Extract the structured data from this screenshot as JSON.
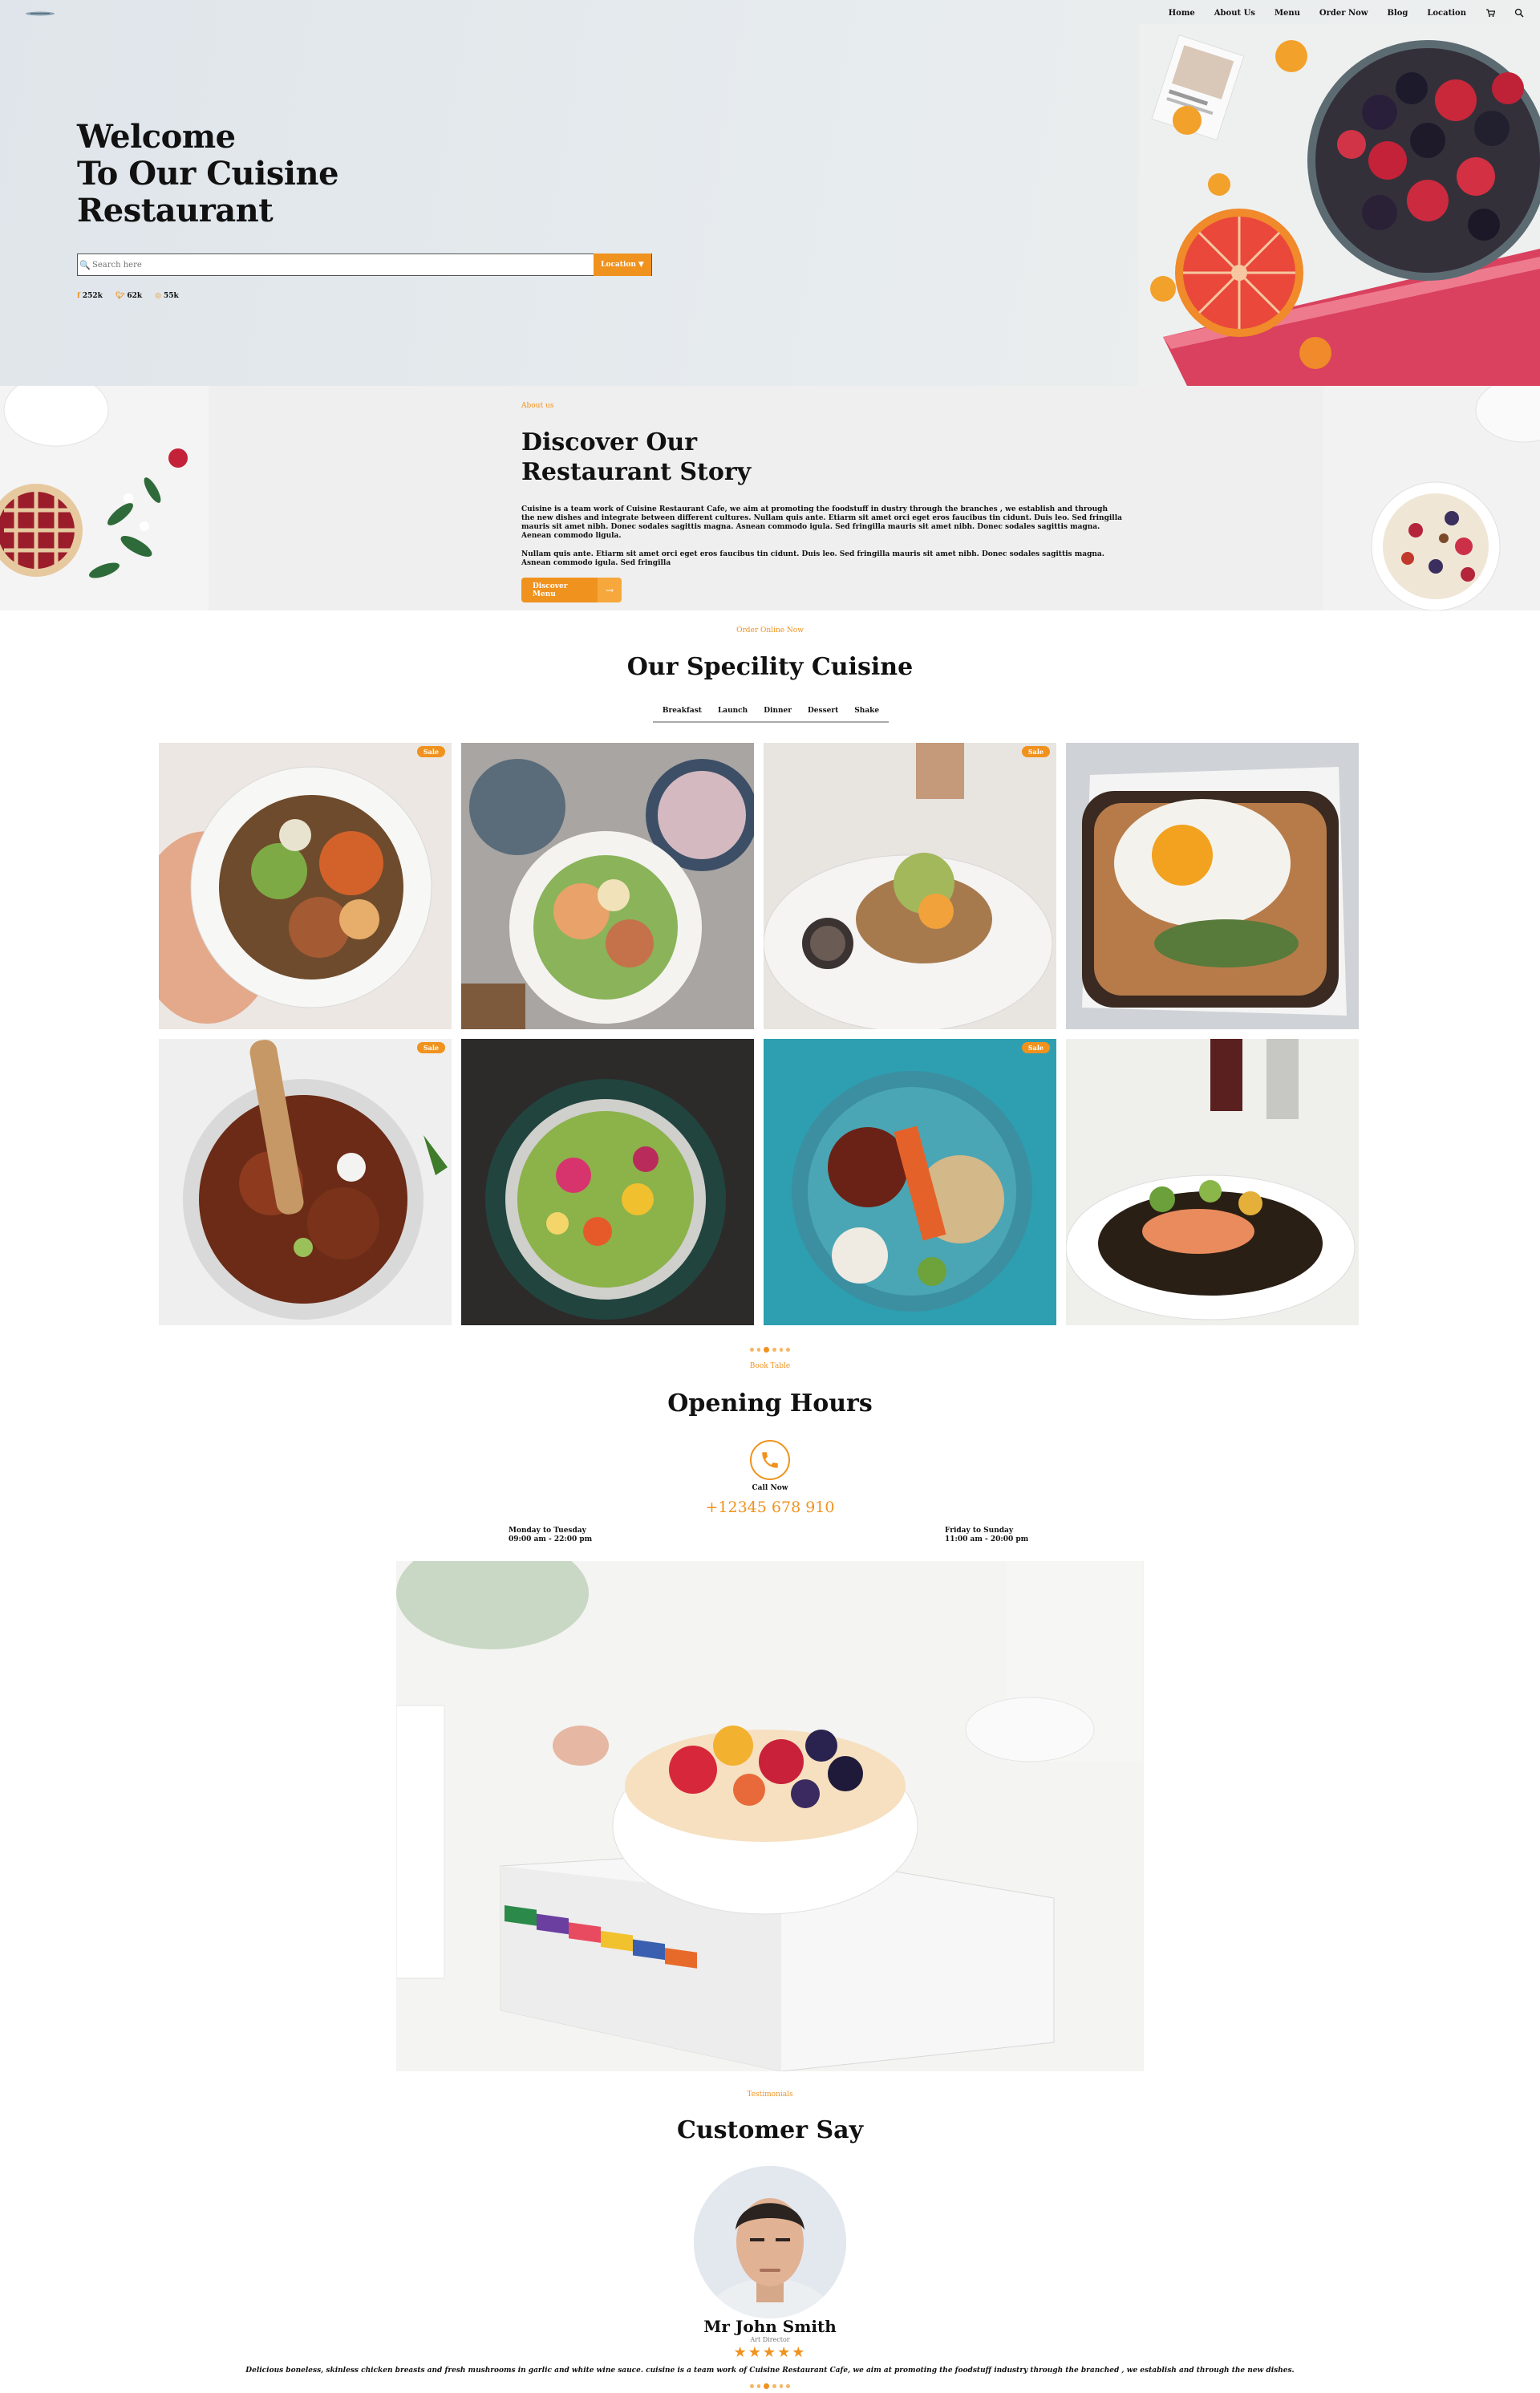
{
  "nav": {
    "items": [
      "Home",
      "About Us",
      "Menu",
      "Order Now",
      "Blog",
      "Location"
    ],
    "cart_icon": "cart-icon",
    "search_icon": "search-icon"
  },
  "hero": {
    "title_line1": "Welcome",
    "title_line2": "To Our Cuisine",
    "title_line3": "Restaurant",
    "search_placeholder": "Search here",
    "location_label": "Location",
    "socials": [
      {
        "icon": "facebook-icon",
        "count": "252k"
      },
      {
        "icon": "twitter-icon",
        "count": "62k"
      },
      {
        "icon": "instagram-icon",
        "count": "55k"
      }
    ]
  },
  "about": {
    "kicker": "About us",
    "title_line1": "Discover Our",
    "title_line2": "Restaurant Story",
    "paragraph1": "Cuisine is a team work of Cuisine Restaurant Cafe, we aim at promoting the foodstuff in dustry through the branches , we establish and through the new dishes and integrate between different cultures. Nullam quis ante. Etiarm sit amet orci eget eros faucibus tin cidunt. Duis leo. Sed fringilla mauris sit amet nibh. Donec sodales sagittis magna. Asnean commodo igula. Sed fringilla mauris sit amet nibh. Donec sodales sagittis magna. Aenean commodo ligula.",
    "paragraph2": "Nullam quis ante. Etiarm sit amet orci eget eros faucibus tin cidunt. Duis leo. Sed fringilla mauris sit amet nibh. Donec sodales sagittis magna. Asnean commodo igula. Sed fringilla",
    "button_label": "Discover Menu"
  },
  "specialty": {
    "kicker": "Order Online Now",
    "title": "Our Specility Cuisine",
    "tabs": [
      "Breakfast",
      "Launch",
      "Dinner",
      "Dessert",
      "Shake"
    ],
    "sale_label": "Sale"
  },
  "hours": {
    "kicker": "Book Table",
    "title": "Opening Hours",
    "call_label": "Call Now",
    "phone": "+12345 678 910",
    "left_days": "Monday to Tuesday",
    "left_time": "09:00 am - 22:00 pm",
    "right_days": "Friday to Sunday",
    "right_time": "11:00 am - 20:00 pm"
  },
  "testimonials": {
    "kicker": "Testimonials",
    "title": "Customer Say",
    "name": "Mr John Smith",
    "role": "Art Director",
    "stars": "★★★★★",
    "rating": 5,
    "quote": "Delicious boneless, skinless chicken breasts and fresh mushrooms in garlic and white wine sauce. cuisine is a team work of Cuisine Restaurant Cafe, we aim at promoting the foodstuff industry through the branched , we establish and through the new dishes."
  },
  "colors": {
    "accent": "#f0921e",
    "hero_bg": "#e2e8ec",
    "about_bg": "#efefef"
  }
}
